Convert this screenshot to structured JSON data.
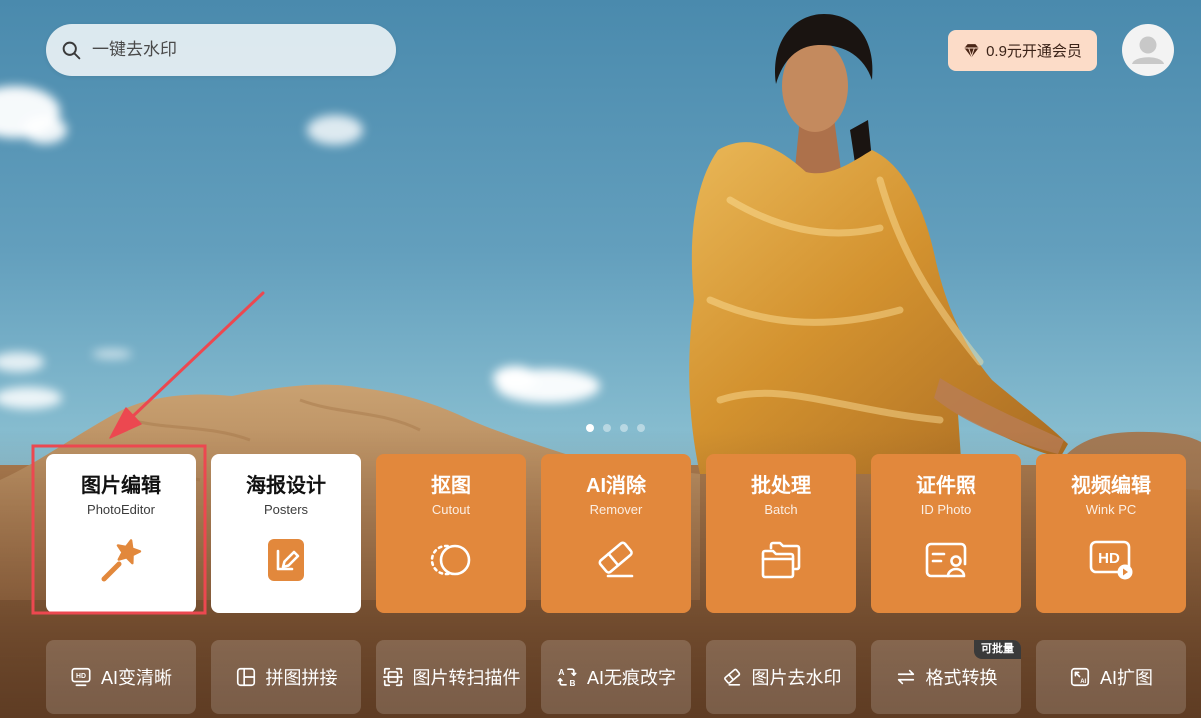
{
  "search": {
    "placeholder": "一键去水印",
    "icon": "search-icon"
  },
  "membership": {
    "label": "0.9元开通会员",
    "icon": "diamond-icon"
  },
  "profile": {
    "icon": "user-icon"
  },
  "banner": {
    "slides": 4,
    "active_slide": 1
  },
  "tools": [
    {
      "title": "图片编辑",
      "subtitle": "PhotoEditor",
      "icon": "magic-wand-icon",
      "background": "#ffffff"
    },
    {
      "title": "海报设计",
      "subtitle": "Posters",
      "icon": "poster-edit-icon",
      "background": "#ffffff"
    },
    {
      "title": "抠图",
      "subtitle": "Cutout",
      "icon": "cutout-icon",
      "background": "#e2883c"
    },
    {
      "title": "AI消除",
      "subtitle": "Remover",
      "icon": "eraser-icon",
      "background": "#e2883c"
    },
    {
      "title": "批处理",
      "subtitle": "Batch",
      "icon": "folders-icon",
      "background": "#e2883c"
    },
    {
      "title": "证件照",
      "subtitle": "ID Photo",
      "icon": "id-card-icon",
      "background": "#e2883c"
    },
    {
      "title": "视频编辑",
      "subtitle": "Wink PC",
      "icon": "hd-video-icon",
      "icon_text": "HD",
      "background": "#e2883c"
    }
  ],
  "quick_tools": [
    {
      "label": "AI变清晰",
      "icon": "hd-icon",
      "icon_text": "HD"
    },
    {
      "label": "拼图拼接",
      "icon": "collage-icon"
    },
    {
      "label": "图片转扫描件",
      "icon": "scan-icon"
    },
    {
      "label": "AI无痕改字",
      "icon": "text-replace-icon",
      "icon_text": {
        "from": "A",
        "to": "B"
      }
    },
    {
      "label": "图片去水印",
      "icon": "eraser-icon"
    },
    {
      "label": "格式转换",
      "icon": "convert-icon",
      "badge": "可批量"
    },
    {
      "label": "AI扩图",
      "icon": "expand-icon",
      "icon_text": "AI"
    }
  ],
  "colors": {
    "accent": "#e2883c",
    "membership": "#fcdcc8",
    "badge": "#3a3a3a",
    "annotation": "#ec4850"
  }
}
